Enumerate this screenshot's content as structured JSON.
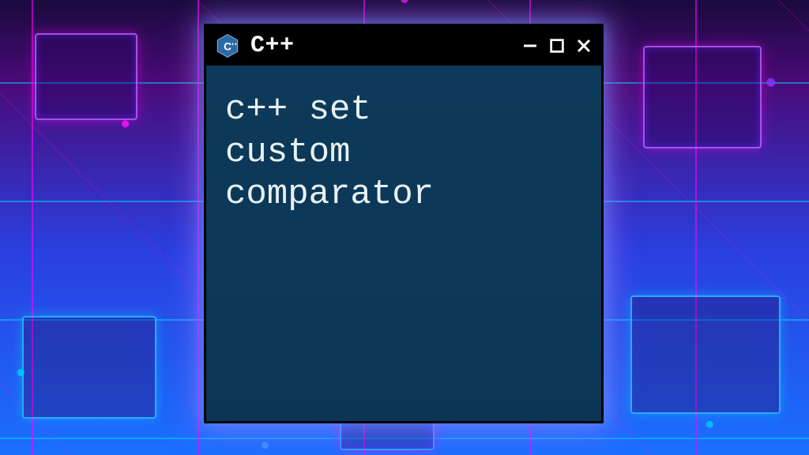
{
  "window": {
    "icon_label": "C++",
    "title": "C++",
    "body_text": "c++ set\ncustom\ncomparator",
    "controls": {
      "minimize_glyph": "minimize",
      "maximize_glyph": "maximize",
      "close_glyph": "close"
    }
  },
  "colors": {
    "window_bg": "#0d3a5a",
    "titlebar_bg": "#000000",
    "text": "#e8f1f5",
    "glow_magenta": "#ff28c8",
    "glow_cyan": "#00b4ff",
    "cpp_icon_fill": "#2a6aa5"
  }
}
